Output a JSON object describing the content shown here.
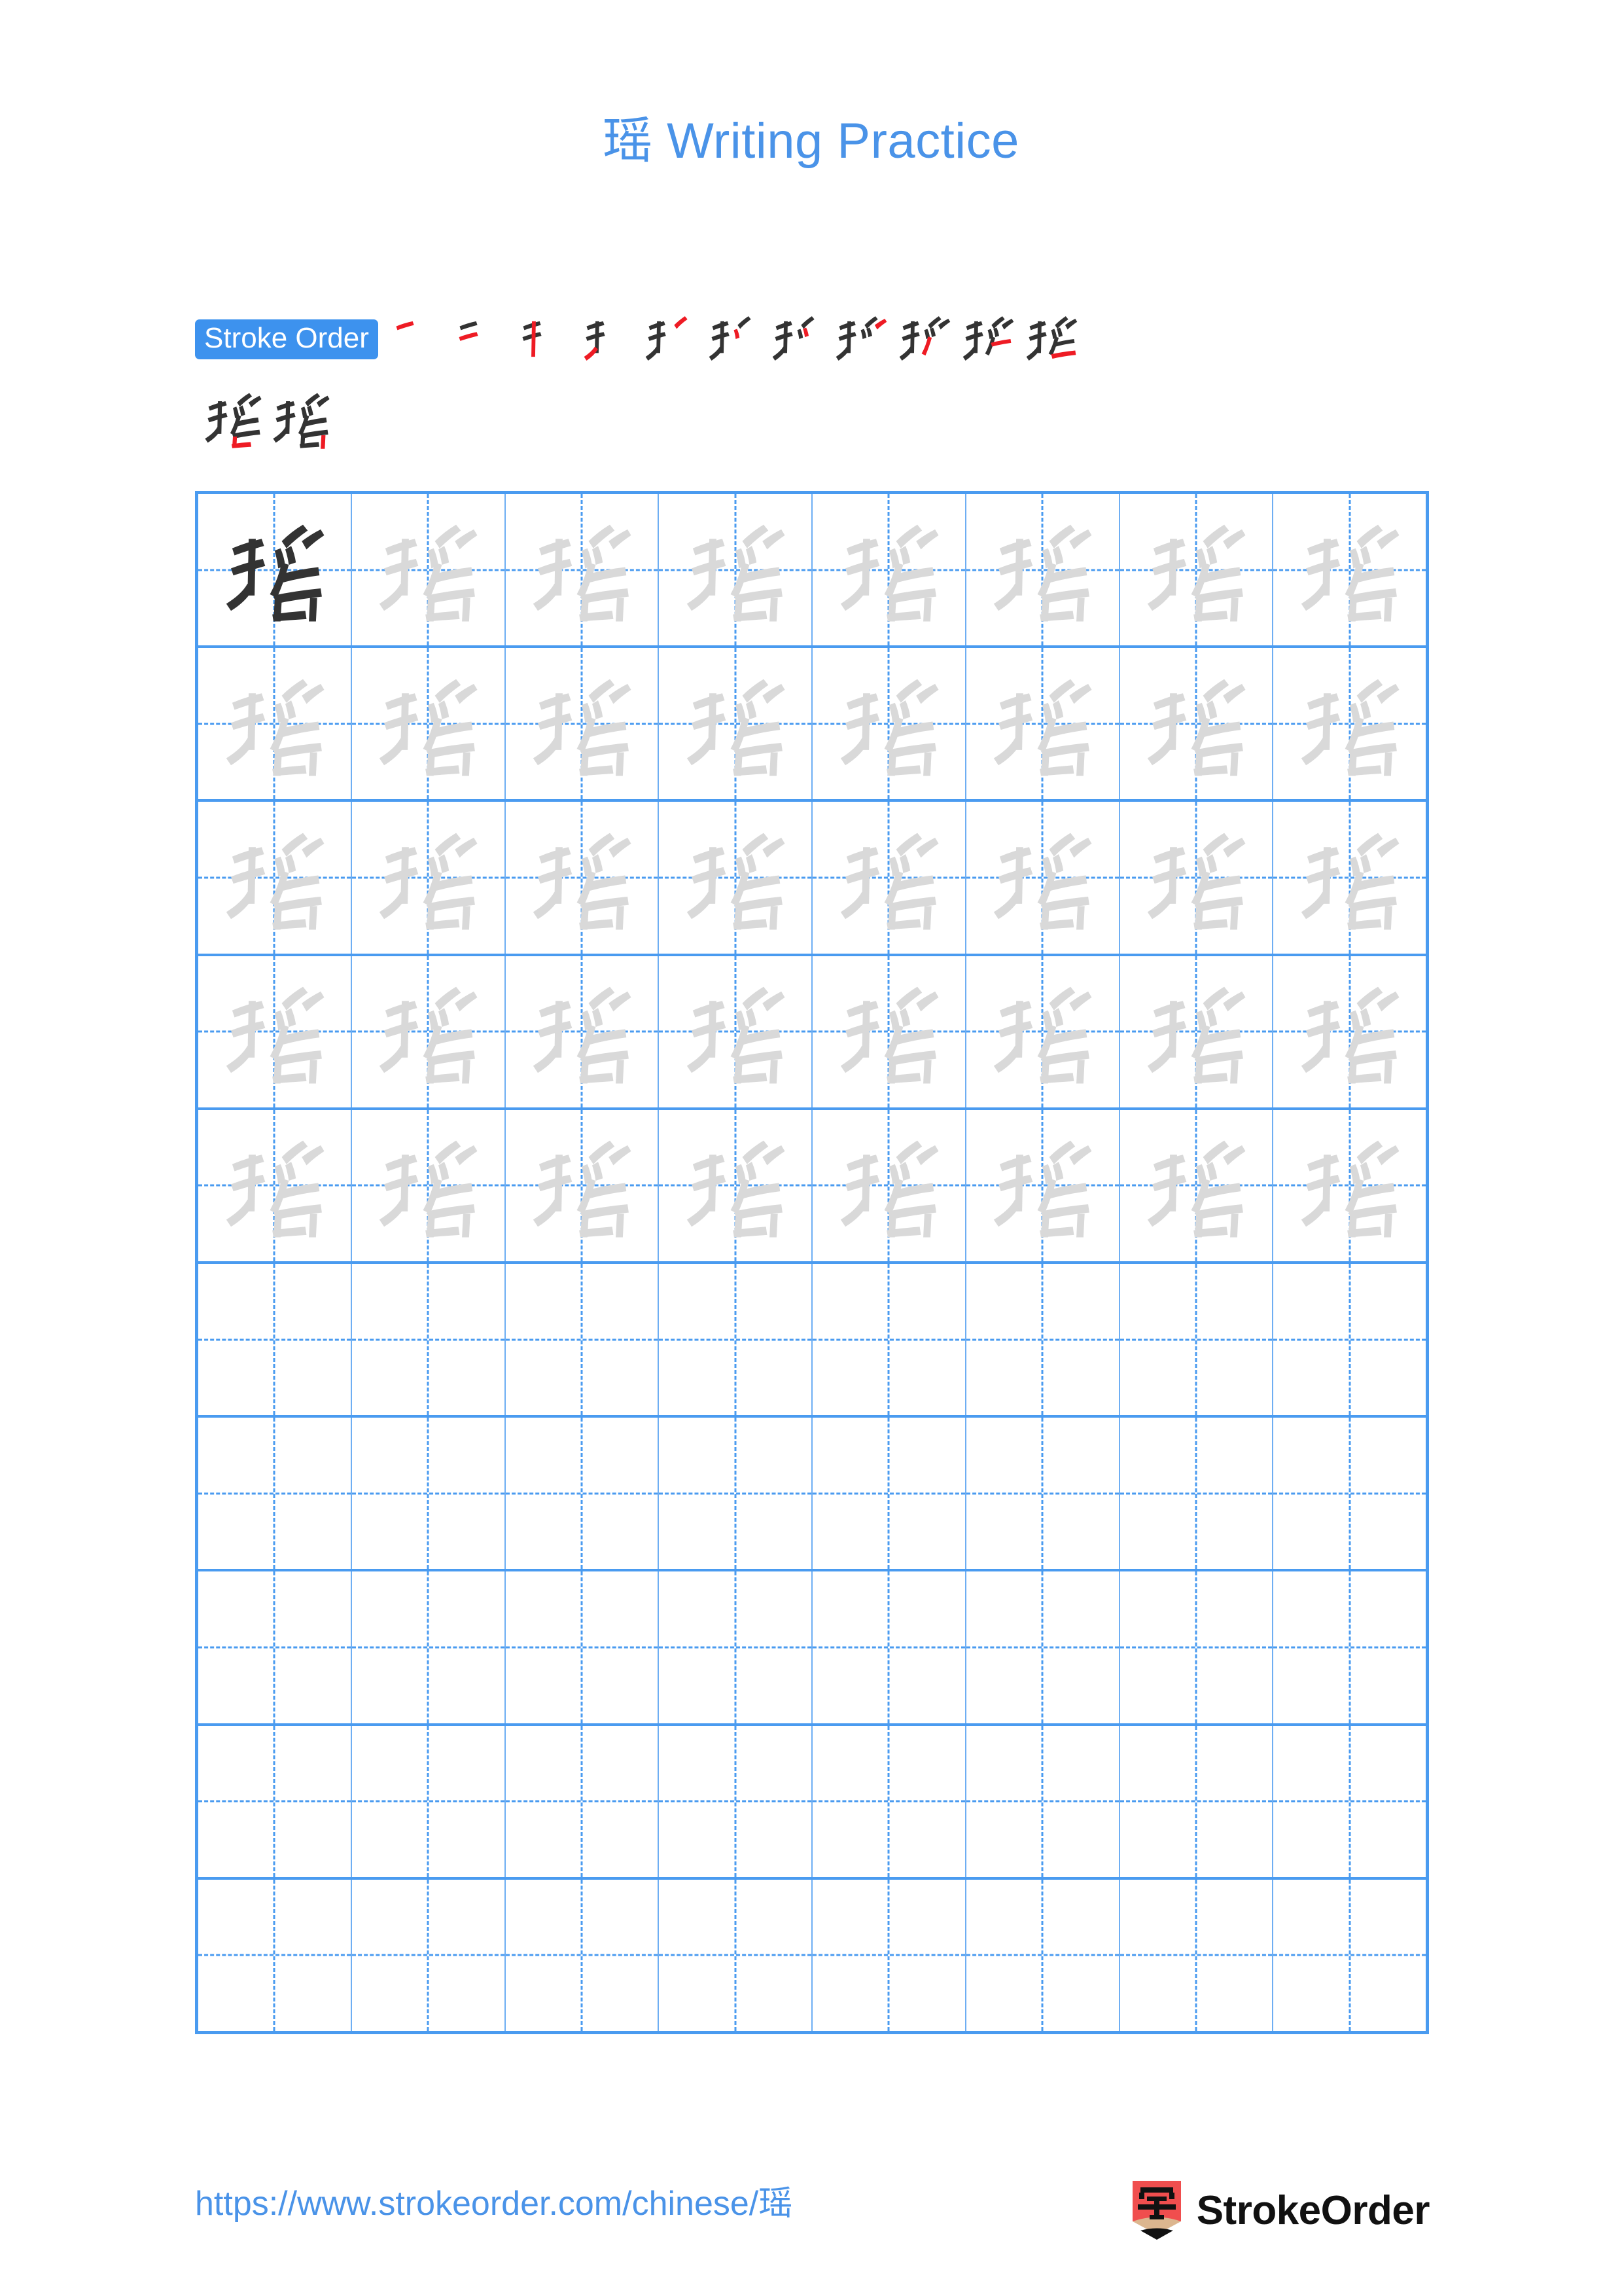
{
  "title": "瑶 Writing Practice",
  "character": "瑶",
  "colors": {
    "accent_blue": "#4a93e8",
    "grid_blue": "#4a9bf0",
    "badge_blue": "#3d92ee",
    "new_stroke_red": "#ee1b24",
    "ink_dark": "#333333",
    "ink_trace": "#d9d9d9",
    "logo_red": "#f04e4e"
  },
  "stroke_order": {
    "badge_label": "Stroke Order",
    "total_strokes": 13,
    "steps_row_1": [
      1,
      2,
      3,
      4,
      5,
      6,
      7,
      8,
      9,
      10,
      11
    ],
    "steps_row_2": [
      12,
      13
    ]
  },
  "practice_grid": {
    "columns": 8,
    "rows": 10,
    "filled_rows": 5,
    "model_cell": {
      "row": 1,
      "column": 1
    },
    "cell_character": "瑶"
  },
  "footer": {
    "url": "https://www.strokeorder.com/chinese/瑶",
    "brand_name": "StrokeOrder",
    "logo_glyph": "字"
  }
}
